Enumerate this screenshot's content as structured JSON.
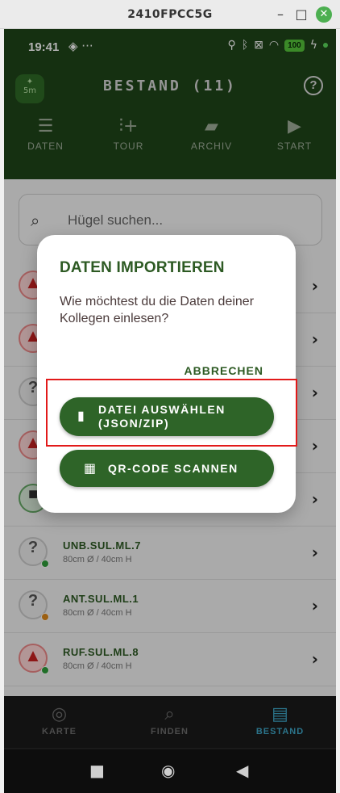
{
  "window": {
    "title": "2410FPCC5G",
    "minimize": "–",
    "maximize": "□",
    "close": "✕"
  },
  "statusbar": {
    "time": "19:41",
    "left_icons": "◈ ···",
    "battery": "100"
  },
  "header": {
    "title": "BESTAND (11)",
    "logo_label": "5m",
    "help": "?",
    "tabs": [
      {
        "label": "DATEN",
        "icon": "database-icon",
        "glyph": "☰"
      },
      {
        "label": "TOUR",
        "icon": "route-add-icon",
        "glyph": "⫶+"
      },
      {
        "label": "ARCHIV",
        "icon": "folder-star-icon",
        "glyph": "▰"
      },
      {
        "label": "START",
        "icon": "play-icon",
        "glyph": "▶"
      }
    ]
  },
  "search": {
    "placeholder": "Hügel suchen..."
  },
  "list": [
    {
      "name": "UNB.SUL.ML.7",
      "sub": "80cm Ø / 40cm H",
      "badge_color": "#2e9e3a",
      "kind": "unknown"
    },
    {
      "name": "ANT.SUL.ML.1",
      "sub": "80cm Ø / 40cm H",
      "badge_color": "#e08a1a",
      "kind": "unknown"
    },
    {
      "name": "RUF.SUL.ML.8",
      "sub": "80cm Ø / 40cm H",
      "badge_color": "#2e9e3a",
      "kind": "warning"
    }
  ],
  "bottomnav": [
    {
      "label": "KARTE",
      "glyph": "◎"
    },
    {
      "label": "FINDEN",
      "glyph": "⌕"
    },
    {
      "label": "BESTAND",
      "glyph": "▤"
    }
  ],
  "dialog": {
    "title": "DATEN IMPORTIEREN",
    "text": "Wie möchtest du die Daten deiner Kollegen einlesen?",
    "cancel": "ABBRECHEN",
    "file_button_line1": "DATEI AUSWÄHLEN",
    "file_button_line2": "(JSON/ZIP)",
    "qr_button": "QR-CODE SCANNEN"
  },
  "colors": {
    "brand_dark": "#1f4519",
    "button": "#2e6428",
    "accent": "#3ea7c8",
    "highlight": "#e21a1a"
  }
}
